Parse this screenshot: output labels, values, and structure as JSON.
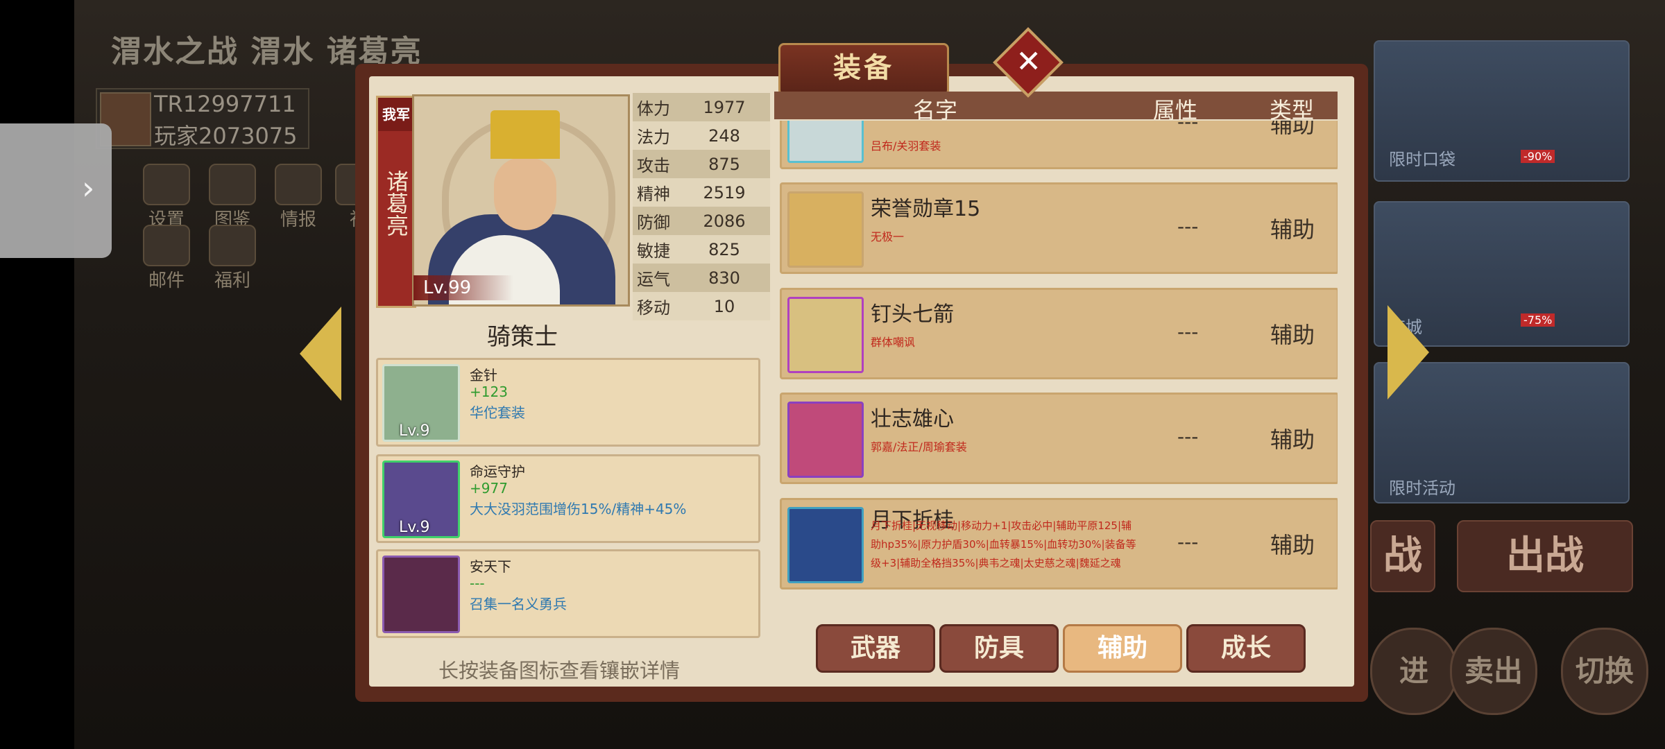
{
  "background": {
    "title": "渭水之战 渭水 诸葛亮",
    "player_id": "TR12997711",
    "player_name": "玩家2073075",
    "menu": [
      {
        "label": "设置",
        "icon": "gear-icon"
      },
      {
        "label": "图鉴",
        "icon": "book-icon"
      },
      {
        "label": "情报",
        "icon": "intel-icon"
      },
      {
        "label": "社",
        "icon": "social-icon"
      },
      {
        "label": "邮件",
        "icon": "mail-icon"
      },
      {
        "label": "福利",
        "icon": "gift-icon"
      }
    ],
    "promo": [
      {
        "label": "限时口袋",
        "badge": "-90%"
      },
      {
        "label": "商城",
        "badge": "-75%"
      },
      {
        "label": "限时活动",
        "badge": ""
      }
    ],
    "battle_buttons": [
      "战",
      "出战"
    ],
    "bottom_buttons": [
      "进",
      "卖出",
      "切换"
    ]
  },
  "dialog": {
    "title": "装备",
    "close_label": "✕",
    "hero": {
      "faction": "我军",
      "name": "诸葛亮",
      "level": "Lv.99",
      "role": "骑策士",
      "stats": [
        {
          "k": "体力",
          "v": "1977"
        },
        {
          "k": "法力",
          "v": "248"
        },
        {
          "k": "攻击",
          "v": "875"
        },
        {
          "k": "精神",
          "v": "2519"
        },
        {
          "k": "防御",
          "v": "2086"
        },
        {
          "k": "敏捷",
          "v": "825"
        },
        {
          "k": "运气",
          "v": "830"
        },
        {
          "k": "移动",
          "v": "10"
        }
      ]
    },
    "equipped": [
      {
        "name": "金针",
        "plus": "+123",
        "set": "华佗套装",
        "level": "Lv.9"
      },
      {
        "name": "命运守护",
        "plus": "+977",
        "set": "大大没羽范围增伤15%/精神+45%",
        "level": "Lv.9"
      },
      {
        "name": "安天下",
        "plus": "---",
        "set": "召集一名义勇兵",
        "level": ""
      }
    ],
    "hint": "长按装备图标查看镶嵌详情",
    "list_header": {
      "name": "名字",
      "attr": "属性",
      "type": "类型"
    },
    "items": [
      {
        "name": "",
        "desc": "吕布/关羽套装",
        "attr": "---",
        "type": "辅助"
      },
      {
        "name": "荣誉勋章15",
        "desc": "无极一",
        "attr": "---",
        "type": "辅助"
      },
      {
        "name": "钉头七箭",
        "desc": "群体嘲讽",
        "attr": "---",
        "type": "辅助"
      },
      {
        "name": "壮志雄心",
        "desc": "郭嘉/法正/周瑜套装",
        "attr": "---",
        "type": "辅助"
      },
      {
        "name": "月下折桂",
        "desc": "月下折桂|无视移动|移动力+1|攻击必中|辅助平原125|辅助hp35%|原力护盾30%|血转暴15%|血转功30%|装备等级+3|辅助全格挡35%|典韦之魂|太史慈之魂|魏延之魂",
        "attr": "---",
        "type": "辅助"
      }
    ],
    "tabs": [
      "武器",
      "防具",
      "辅助",
      "成长"
    ],
    "active_tab": "辅助"
  }
}
